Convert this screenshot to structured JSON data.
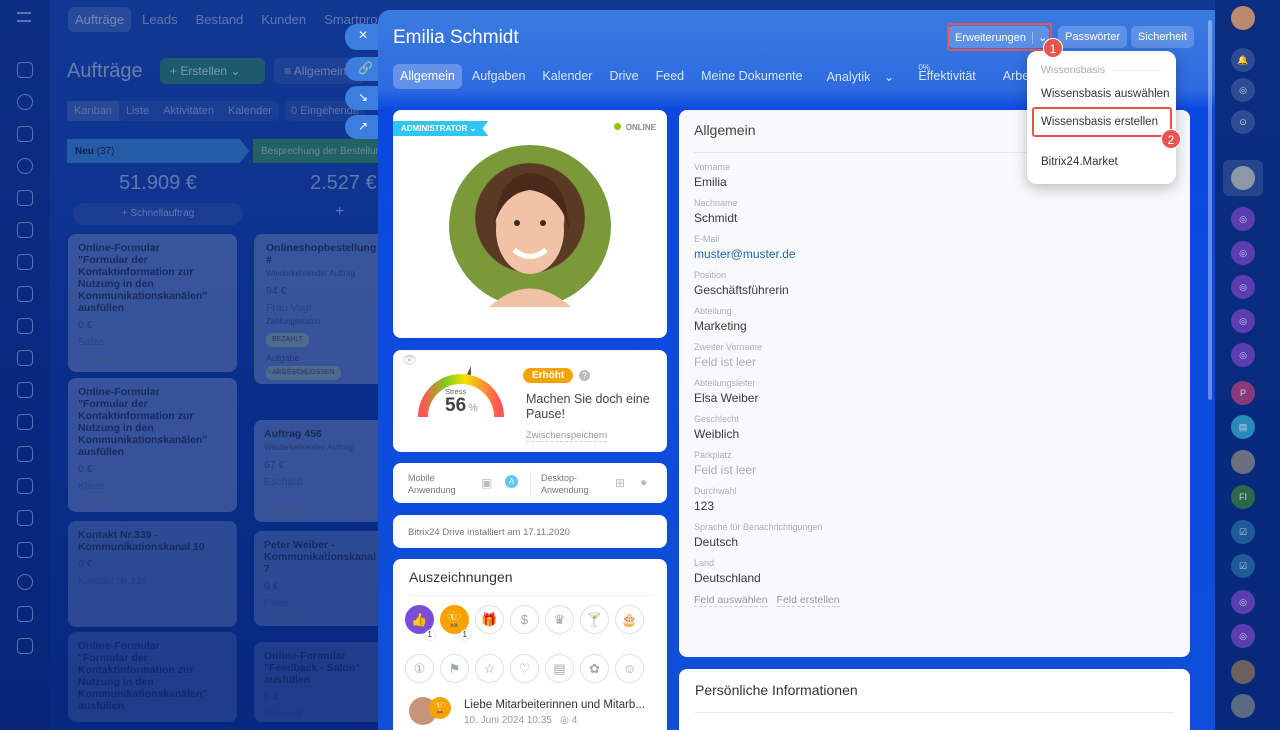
{
  "background": {
    "nav": [
      "Aufträge",
      "Leads",
      "Bestand",
      "Kunden",
      "Smartpro"
    ],
    "page_title": "Aufträge",
    "create_button": "Erstellen",
    "filter_button": "Allgemein",
    "view_tabs": [
      "Kanban",
      "Liste",
      "Aktivitäten",
      "Kalender"
    ],
    "incoming_count": "0",
    "incoming_label": "Eingehende",
    "columns": [
      {
        "title": "Neu",
        "count": "(37)",
        "sum": "51.909 €",
        "quick_add": "Schnellauftrag",
        "cards": [
          {
            "title": "Online-Formular \"Formular der Kontaktinformation zur Nutzung in den Kommunikationskanälen\" ausfüllen",
            "amount": "0 €",
            "contact": "Salze",
            "add": "+ Aktivität",
            "count": "0"
          },
          {
            "title": "Online-Formular \"Formular der Kontaktinformation zur Nutzung in den Kommunikationskanälen\" ausfüllen",
            "amount": "0 €",
            "contact": "Klaus",
            "add": "+ Aktivität",
            "count": "0"
          },
          {
            "title": "Kontakt Nr.339 - Kommunikationskanal 10",
            "amount": "0 €",
            "contact": "Kontakt Nr.339",
            "add": "+ Aktivität",
            "count": "0"
          },
          {
            "title": "Online-Formular \"Formular der Kontaktinformation zur Nutzung in den Kommunikationskanälen\" ausfüllen",
            "amount": "",
            "contact": "",
            "add": "",
            "count": "0"
          }
        ]
      },
      {
        "title": "Besprechung der Bestellung",
        "count": "",
        "sum": "2.527 €",
        "quick_add": "+",
        "cards": [
          {
            "title": "Onlineshopbestellung #",
            "sub": "Wiederkehrender Auftrag",
            "amount": "94 €",
            "contact": "Frau Vogt",
            "status_label": "Zahlungsstatus",
            "status": "BEZAHLT",
            "task_label": "Aufgabe",
            "task": "ABGESCHLOSSEN",
            "add": "+ Aktivität"
          },
          {
            "title": "Auftrag 456",
            "sub": "Wiederkehrender Auftrag",
            "amount": "67 €",
            "contact": "Eschard",
            "add": "+ Aktivität"
          },
          {
            "title": "Peter Weiber - Kommunikationskanal 7",
            "amount": "0 €",
            "contact": "Peter",
            "add": "+ Aktivität"
          },
          {
            "title": "Online-Formular \"Feedback - Salon\" ausfüllen",
            "amount": "0 €",
            "contact": "Schmidt"
          }
        ]
      }
    ]
  },
  "panel": {
    "title": "Emilia Schmidt",
    "tabs": [
      "Allgemein",
      "Aufgaben",
      "Kalender",
      "Drive",
      "Feed",
      "Meine Dokumente",
      "Analytik",
      "Effektivität",
      "Arbeitszeit"
    ],
    "effectivity_percent": "0%",
    "header_buttons": {
      "extensions": "Erweiterungen",
      "passwords": "Passwörter",
      "security": "Sicherheit"
    },
    "profile": {
      "role": "ADMINISTRATOR",
      "status": "ONLINE"
    },
    "stress": {
      "label": "Stress",
      "value": "56",
      "unit": "%",
      "level": "Erhöht",
      "message": "Machen Sie doch eine Pause!",
      "save": "Zwischenspeichern",
      "percent": 56
    },
    "apps": {
      "mobile": "Mobile Anwendung",
      "desktop": "Desktop-Anwendung"
    },
    "drive": "Bitrix24 Drive installiert am 17.11.2020",
    "awards": {
      "title": "Auszeichnungen",
      "counts": [
        "1",
        "1"
      ],
      "post_title": "Liebe Mitarbeiterinnen und Mitarb...",
      "post_meta": "10. Juni 2024 10:35   ◎ 4"
    },
    "general": {
      "title": "Allgemein",
      "fields": [
        {
          "label": "Vorname",
          "value": "Emilia"
        },
        {
          "label": "Nachname",
          "value": "Schmidt"
        },
        {
          "label": "E-Mail",
          "value": "muster@muster.de",
          "type": "link"
        },
        {
          "label": "Position",
          "value": "Geschäftsführerin"
        },
        {
          "label": "Abteilung",
          "value": "Marketing"
        },
        {
          "label": "Zweiter Vorname",
          "value": "Feld ist leer",
          "type": "empty"
        },
        {
          "label": "Abteilungsleiter",
          "value": "Elsa Weiber"
        },
        {
          "label": "Geschlecht",
          "value": "Weiblich"
        },
        {
          "label": "Parkplatz",
          "value": "Feld ist leer",
          "type": "empty"
        },
        {
          "label": "Durchwahl",
          "value": "123"
        },
        {
          "label": "Sprache für Benachrichtigungen",
          "value": "Deutsch"
        },
        {
          "label": "Land",
          "value": "Deutschland"
        }
      ],
      "select_field": "Feld auswählen",
      "create_field": "Feld erstellen"
    },
    "personal": {
      "title": "Persönliche Informationen"
    }
  },
  "dropdown": {
    "section": "Wissensbasis",
    "items": [
      "Wissensbasis auswählen",
      "Wissensbasis erstellen",
      "Bitrix24.Market"
    ]
  },
  "callouts": [
    "1",
    "2"
  ],
  "rightbar": {
    "letters": [
      "P",
      "FI"
    ]
  },
  "colors": {
    "accent": "#2f6ee0",
    "highlight": "#e8554e",
    "stress_badge": "#f5a300",
    "online": "#8bc600"
  }
}
